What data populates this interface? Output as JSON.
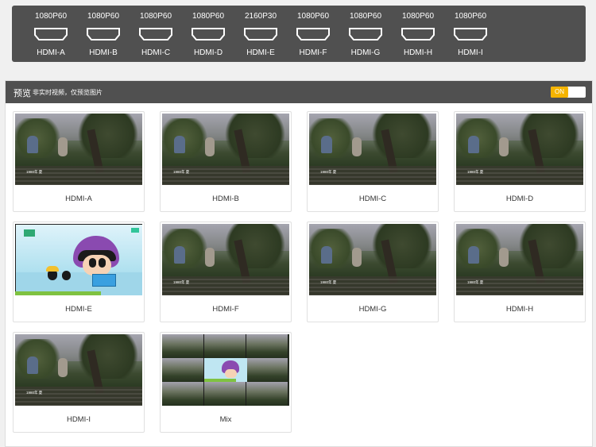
{
  "inputs": [
    {
      "name": "HDMI-A",
      "resolution": "1080P60"
    },
    {
      "name": "HDMI-B",
      "resolution": "1080P60"
    },
    {
      "name": "HDMI-C",
      "resolution": "1080P60"
    },
    {
      "name": "HDMI-D",
      "resolution": "1080P60"
    },
    {
      "name": "HDMI-E",
      "resolution": "2160P30"
    },
    {
      "name": "HDMI-F",
      "resolution": "1080P60"
    },
    {
      "name": "HDMI-G",
      "resolution": "1080P60"
    },
    {
      "name": "HDMI-H",
      "resolution": "1080P60"
    },
    {
      "name": "HDMI-I",
      "resolution": "1080P60"
    }
  ],
  "preview": {
    "title": "预览",
    "subtitle": "非实时视频，仅预览图片",
    "toggle_label": "ON",
    "toggle_on": true,
    "toggle_color": "#f5b400",
    "thumbnail_caption": "1980年 夏",
    "cards": [
      {
        "label": "HDMI-A",
        "thumb": "forest"
      },
      {
        "label": "HDMI-B",
        "thumb": "forest"
      },
      {
        "label": "HDMI-C",
        "thumb": "forest"
      },
      {
        "label": "HDMI-D",
        "thumb": "forest"
      },
      {
        "label": "HDMI-E",
        "thumb": "cartoon"
      },
      {
        "label": "HDMI-F",
        "thumb": "forest"
      },
      {
        "label": "HDMI-G",
        "thumb": "forest"
      },
      {
        "label": "HDMI-H",
        "thumb": "forest"
      },
      {
        "label": "HDMI-I",
        "thumb": "forest"
      },
      {
        "label": "Mix",
        "thumb": "mix"
      }
    ]
  },
  "colors": {
    "bar_bg": "#505050",
    "page_bg": "#f0f0f0"
  },
  "icons": {
    "port_icon": "hdmi-port-icon"
  }
}
